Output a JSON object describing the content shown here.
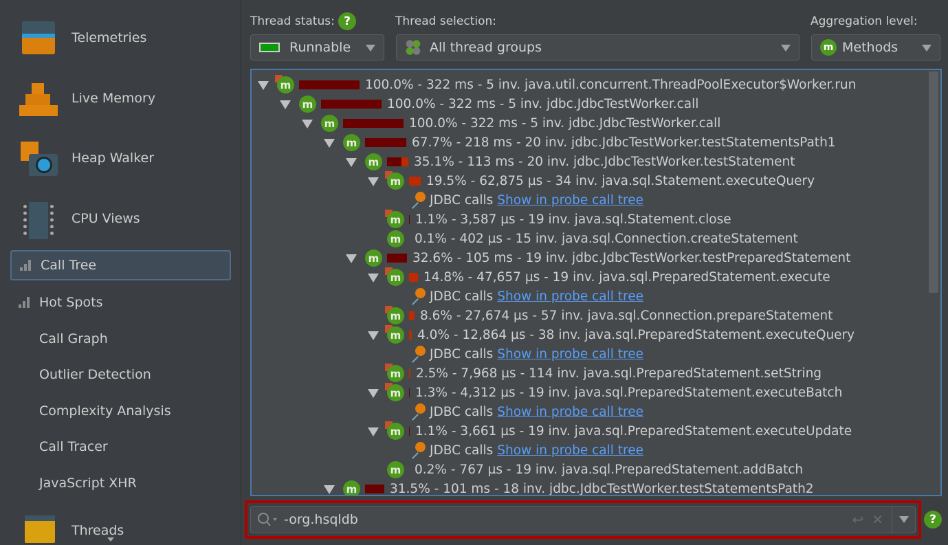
{
  "sidebar": {
    "big_items": [
      {
        "label": "Telemetries",
        "icon": "telemetries-icon"
      },
      {
        "label": "Live Memory",
        "icon": "live-memory-icon"
      },
      {
        "label": "Heap Walker",
        "icon": "heap-walker-icon"
      },
      {
        "label": "CPU Views",
        "icon": "cpu-views-icon"
      },
      {
        "label": "Threads",
        "icon": "threads-icon"
      }
    ],
    "cpu_items": [
      {
        "label": "Call Tree",
        "selected": true
      },
      {
        "label": "Hot Spots"
      },
      {
        "label": "Call Graph"
      },
      {
        "label": "Outlier Detection"
      },
      {
        "label": "Complexity Analysis"
      },
      {
        "label": "Call Tracer"
      },
      {
        "label": "JavaScript XHR"
      }
    ]
  },
  "toolbar": {
    "thread_status_label": "Thread status:",
    "thread_status_value": "Runnable",
    "thread_status_color": "#0a9a0a",
    "thread_selection_label": "Thread selection:",
    "thread_selection_value": "All thread groups",
    "aggregation_label": "Aggregation level:",
    "aggregation_value": "Methods",
    "help": "?"
  },
  "tree": {
    "probe_label": "JDBC calls",
    "probe_link": "Show in probe call tree",
    "rows": [
      {
        "level": 0,
        "toggle": true,
        "hot": true,
        "pct": 100.0,
        "self": 0,
        "text": "100.0% - 322 ms - 5 inv. java.util.concurrent.ThreadPoolExecutor$Worker.run"
      },
      {
        "level": 1,
        "toggle": true,
        "pct": 100.0,
        "self": 0,
        "text": "100.0% - 322 ms - 5 inv. jdbc.JdbcTestWorker.call"
      },
      {
        "level": 2,
        "toggle": true,
        "pct": 100.0,
        "self": 0,
        "text": "100.0% - 322 ms - 5 inv. jdbc.JdbcTestWorker.call"
      },
      {
        "level": 3,
        "toggle": true,
        "pct": 67.7,
        "self": 0,
        "text": "67.7% - 218 ms - 20 inv. jdbc.JdbcTestWorker.testStatementsPath1"
      },
      {
        "level": 4,
        "toggle": true,
        "pct": 35.1,
        "self": 11,
        "text": "35.1% - 113 ms - 20 inv. jdbc.JdbcTestWorker.testStatement"
      },
      {
        "level": 5,
        "toggle": true,
        "hot": true,
        "pct": 19.5,
        "self": 19.5,
        "text": "19.5% - 62,875 µs - 34 inv. java.sql.Statement.executeQuery"
      },
      {
        "level": 6,
        "probe": true
      },
      {
        "level": 5,
        "hot": true,
        "pct": 1.1,
        "self": 0,
        "text": "1.1% - 3,587 µs - 19 inv. java.sql.Statement.close"
      },
      {
        "level": 5,
        "pct": 0.1,
        "self": 0,
        "text": "0.1% - 402 µs - 15 inv. java.sql.Connection.createStatement"
      },
      {
        "level": 4,
        "toggle": true,
        "pct": 32.6,
        "self": 0,
        "text": "32.6% - 105 ms - 19 inv. jdbc.JdbcTestWorker.testPreparedStatement"
      },
      {
        "level": 5,
        "toggle": true,
        "hot": true,
        "pct": 14.8,
        "self": 14.8,
        "text": "14.8% - 47,657 µs - 19 inv. java.sql.PreparedStatement.execute"
      },
      {
        "level": 6,
        "probe": true
      },
      {
        "level": 5,
        "hot": true,
        "pct": 8.6,
        "self": 8.6,
        "text": "8.6% - 27,674 µs - 57 inv. java.sql.Connection.prepareStatement"
      },
      {
        "level": 5,
        "toggle": true,
        "hot": true,
        "pct": 4.0,
        "self": 4.0,
        "text": "4.0% - 12,864 µs - 38 inv. java.sql.PreparedStatement.executeQuery"
      },
      {
        "level": 6,
        "probe": true
      },
      {
        "level": 5,
        "hot": true,
        "pct": 2.5,
        "self": 2.5,
        "text": "2.5% - 7,968 µs - 114 inv. java.sql.PreparedStatement.setString"
      },
      {
        "level": 5,
        "toggle": true,
        "hot": true,
        "pct": 1.3,
        "self": 0,
        "text": "1.3% - 4,312 µs - 19 inv. java.sql.PreparedStatement.executeBatch"
      },
      {
        "level": 6,
        "probe": true
      },
      {
        "level": 5,
        "toggle": true,
        "hot": true,
        "pct": 1.1,
        "self": 0,
        "text": "1.1% - 3,661 µs - 19 inv. java.sql.PreparedStatement.executeUpdate"
      },
      {
        "level": 6,
        "probe": true
      },
      {
        "level": 5,
        "pct": 0.2,
        "self": 0,
        "text": "0.2% - 767 µs - 19 inv. java.sql.PreparedStatement.addBatch"
      },
      {
        "level": 3,
        "toggle": true,
        "pct": 31.5,
        "self": 0,
        "text": "31.5% - 101 ms - 18 inv. jdbc.JdbcTestWorker.testStatementsPath2"
      }
    ]
  },
  "filter": {
    "value": "-org.hsqldb"
  }
}
